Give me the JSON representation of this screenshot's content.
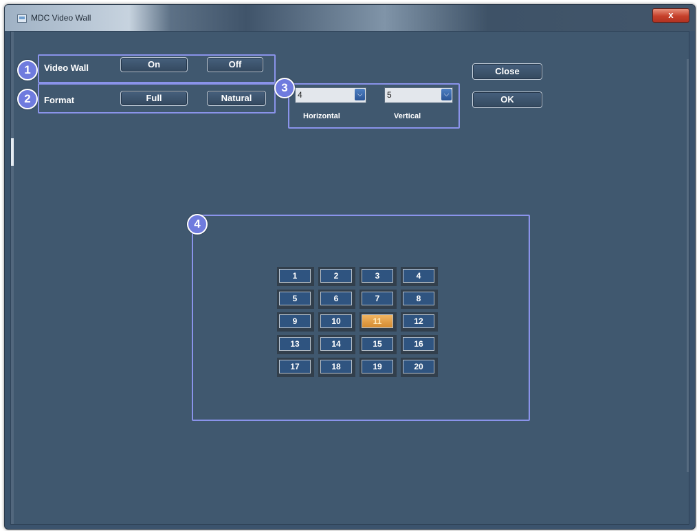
{
  "window": {
    "title": "MDC Video Wall",
    "close_glyph": "x"
  },
  "video_wall": {
    "label": "Video Wall",
    "on_label": "On",
    "off_label": "Off",
    "badge": "1"
  },
  "format": {
    "label": "Format",
    "full_label": "Full",
    "natural_label": "Natural",
    "badge": "2"
  },
  "layout": {
    "badge": "3",
    "horizontal": {
      "value": "4",
      "label": "Horizontal"
    },
    "vertical": {
      "value": "5",
      "label": "Vertical"
    }
  },
  "actions": {
    "close_label": "Close",
    "ok_label": "OK"
  },
  "grid": {
    "badge": "4",
    "columns": 4,
    "rows": 5,
    "selected": "11",
    "cells": [
      "1",
      "2",
      "3",
      "4",
      "5",
      "6",
      "7",
      "8",
      "9",
      "10",
      "11",
      "12",
      "13",
      "14",
      "15",
      "16",
      "17",
      "18",
      "19",
      "20"
    ]
  },
  "colors": {
    "annotation": "#8a93ea",
    "selected_cell": "#e3a347",
    "cell": "#2f5480"
  }
}
